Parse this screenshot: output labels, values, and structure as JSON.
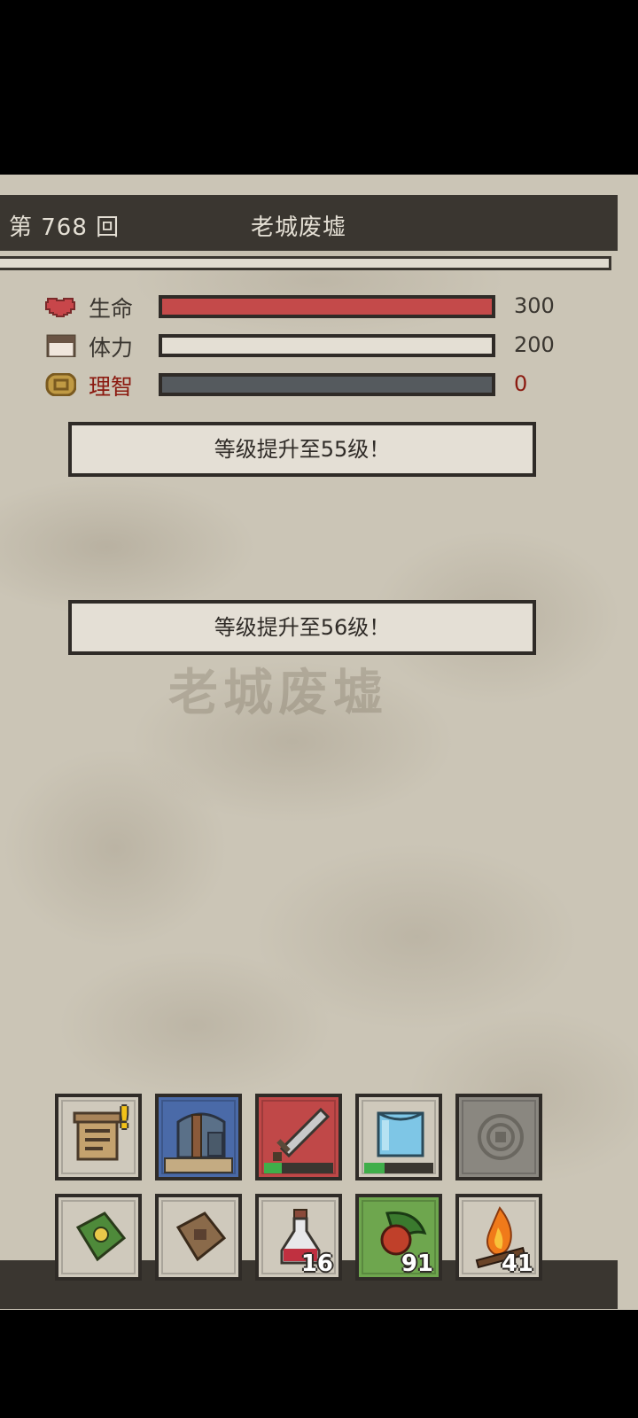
{
  "header": {
    "round": "第 768 回",
    "location": "老城废墟"
  },
  "stats": [
    {
      "label": "生命",
      "value": "300",
      "fill": 1.0,
      "bar_color": "#c44a4a",
      "label_color": "#3a3630",
      "icon": "heart-icon"
    },
    {
      "label": "体力",
      "value": "200",
      "fill": 1.0,
      "bar_color": "#e4dfd4",
      "label_color": "#3a3630",
      "icon": "face-icon"
    },
    {
      "label": "理智",
      "value": "0",
      "fill": 0.0,
      "bar_color": "#505458",
      "label_color": "#8b1a10",
      "icon": "sanity-icon"
    }
  ],
  "messages": [
    "等级提升至55级！",
    "等级提升至56级！"
  ],
  "watermark": "老城废墟",
  "toolbar": {
    "top": [
      {
        "icon": "quest-scroll-icon",
        "alert": "!",
        "color": "#cfc9bc"
      },
      {
        "icon": "backpack-icon",
        "color": "#4a6aa8"
      },
      {
        "icon": "sword-icon",
        "color": "#c04848",
        "durability": 0.25
      },
      {
        "icon": "armor-icon",
        "color": "#cfc9bc",
        "durability": 0.3
      },
      {
        "icon": "empty-rune-icon",
        "color": "#8a8780"
      }
    ],
    "bottom": [
      {
        "icon": "skill-book-icon",
        "color": "#cfc9bc"
      },
      {
        "icon": "journal-icon",
        "color": "#cfc9bc"
      },
      {
        "icon": "potion-icon",
        "color": "#cfc9bc",
        "count": "16"
      },
      {
        "icon": "berry-icon",
        "color": "#6ea64e",
        "count": "91"
      },
      {
        "icon": "campfire-icon",
        "color": "#cfc9bc",
        "count": "41"
      }
    ]
  }
}
